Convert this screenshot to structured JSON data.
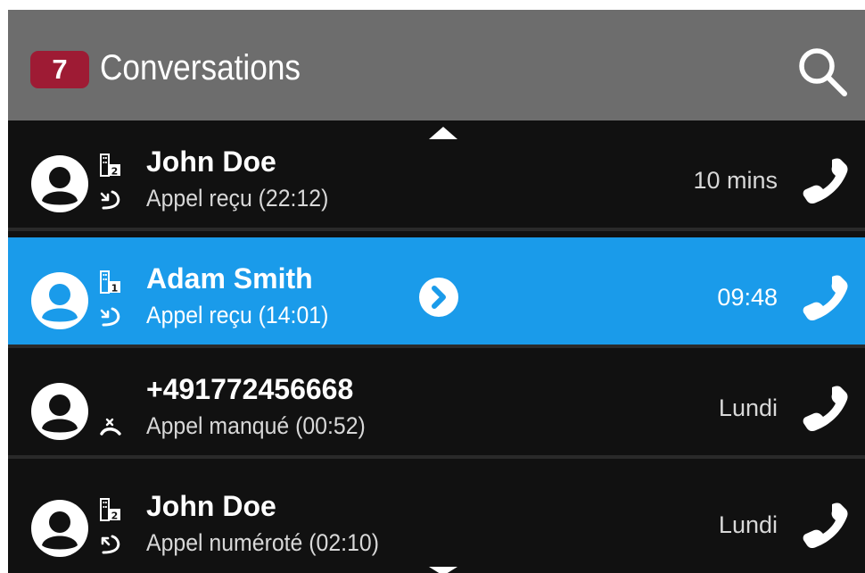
{
  "header": {
    "badge_count": "7",
    "title": "Conversations"
  },
  "icons": {
    "search": "search-icon",
    "avatar": "person-icon",
    "phone": "phone-icon",
    "chevron": "chevron-right-icon",
    "line1": "line-1-icon",
    "line2": "line-2-icon",
    "incoming": "incoming-call-icon",
    "outgoing": "outgoing-call-icon",
    "missed": "missed-call-icon"
  },
  "colors": {
    "header_bg": "#6d6d6d",
    "badge_bg": "#9e1b34",
    "list_bg": "#111111",
    "selected_bg": "#1a9bea",
    "text": "#ffffff"
  },
  "conversations": [
    {
      "name": "John Doe",
      "detail": "Appel reçu (22:12)",
      "time": "10 mins",
      "line": "2",
      "call_type": "incoming",
      "selected": false
    },
    {
      "name": "Adam Smith",
      "detail": "Appel reçu (14:01)",
      "time": "09:48",
      "line": "1",
      "call_type": "incoming",
      "selected": true
    },
    {
      "name": "+491772456668",
      "detail": "Appel manqué (00:52)",
      "time": "Lundi",
      "line": "",
      "call_type": "missed",
      "selected": false
    },
    {
      "name": "John Doe",
      "detail": "Appel numéroté (02:10)",
      "time": "Lundi",
      "line": "2",
      "call_type": "outgoing",
      "selected": false
    }
  ]
}
